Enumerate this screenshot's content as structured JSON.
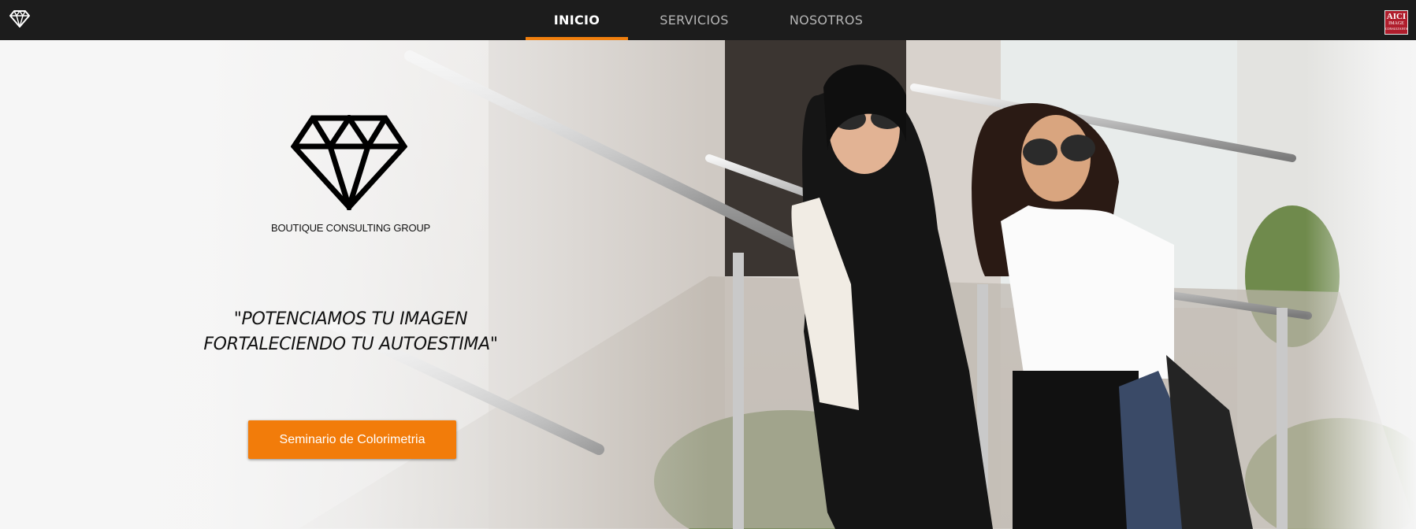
{
  "nav": {
    "items": [
      {
        "label": "INICIO",
        "active": true
      },
      {
        "label": "SERVICIOS",
        "active": false
      },
      {
        "label": "NOSOTROS",
        "active": false
      }
    ],
    "brand_icon": "diamond-icon",
    "accent_color": "#f07f0e",
    "badge": {
      "line1": "AICI",
      "line2": "IMAGE",
      "line3": "CONSULTANTS"
    }
  },
  "hero": {
    "logo_icon": "diamond-icon",
    "brand_name": "BOUTIQUE CONSULTING GROUP",
    "tagline_line1": "\"POTENCIAMOS TU IMAGEN",
    "tagline_line2": "FORTALECIENDO TU AUTOESTIMA\"",
    "cta_label": "Seminario de Colorimetria",
    "cta_color": "#f27c0a",
    "photo_description_icon": "photo"
  }
}
